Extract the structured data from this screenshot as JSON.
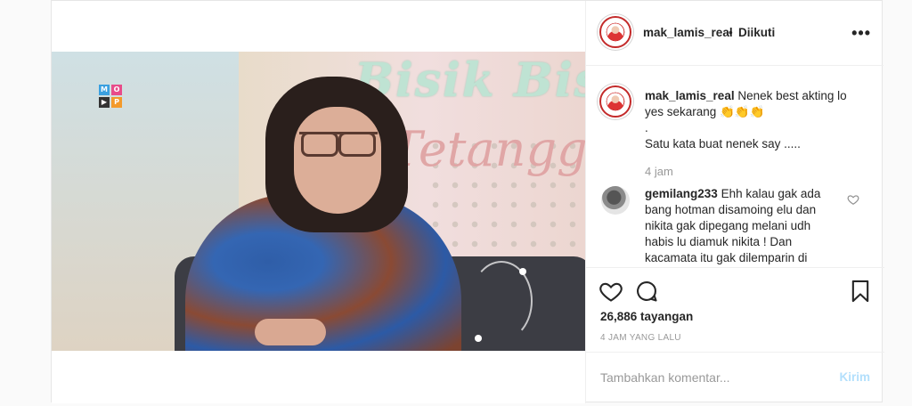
{
  "post": {
    "username": "mak_lamis_real",
    "separator": "•",
    "follow_status": "Diikuti",
    "more_label": "•••"
  },
  "video": {
    "sign_line1": "Bisik Bis",
    "sign_line2": "Tetangga",
    "logo_letters": [
      "M",
      "O",
      "▶",
      "P"
    ]
  },
  "caption": {
    "username": "mak_lamis_real",
    "line1": "Nenek best akting lo",
    "line2": "yes sekarang 👏👏👏",
    "line3": ".",
    "line4": "Satu kata buat nenek say .....",
    "time": "4 jam"
  },
  "comment": {
    "username": "gemilang233",
    "text": "Ehh kalau gak ada bang hotman disamoing elu dan nikita gak dipegang melani udh habis lu diamuk nikita ! Dan kacamata itu gak dilemparin di"
  },
  "stats": {
    "views": "26,886 tayangan",
    "posted_ago": "4 JAM YANG LALU"
  },
  "comment_form": {
    "placeholder": "Tambahkan komentar...",
    "post_label": "Kirim"
  },
  "icons": {
    "like": "heart-icon",
    "comment": "comment-bubble-icon",
    "save": "bookmark-icon",
    "more": "more-options-icon"
  },
  "colors": {
    "text": "#262626",
    "muted": "#999999",
    "post_button_disabled": "#b2dffc",
    "border": "#efefef"
  }
}
